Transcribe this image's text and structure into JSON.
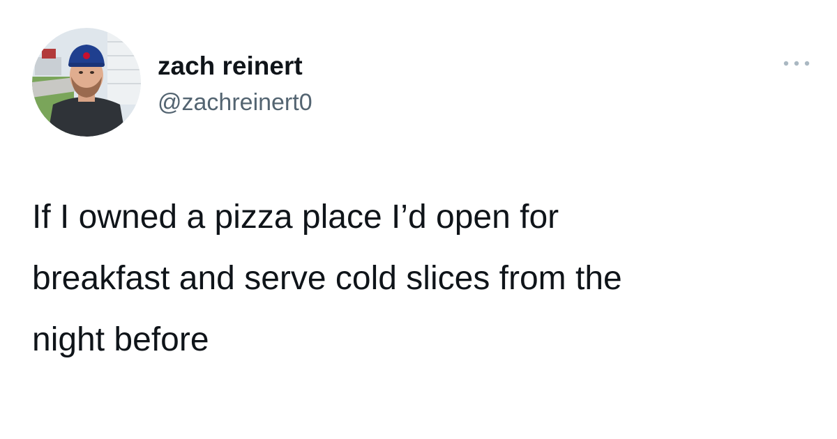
{
  "tweet": {
    "author": {
      "display_name": "zach reinert",
      "handle": "@zachreinert0",
      "avatar_icon": "profile-photo"
    },
    "more_icon": "more-horizontal-icon",
    "text": "If I owned a pizza place I’d open for\nbreakfast and serve cold slices from the\nnight before"
  },
  "colors": {
    "background": "#ffffff",
    "primary_text": "#0f1419",
    "secondary_text": "#536471",
    "icon": "#aab8c2"
  }
}
